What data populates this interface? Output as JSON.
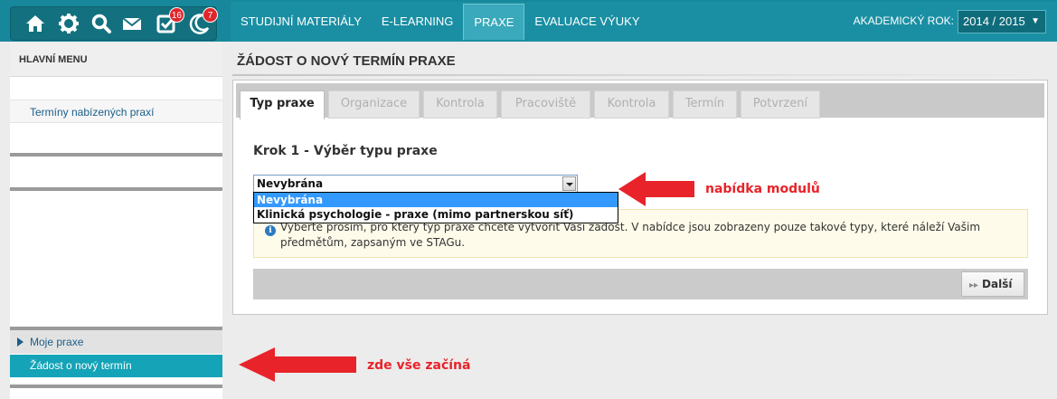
{
  "topbar": {
    "icons": [
      {
        "name": "home-icon"
      },
      {
        "name": "gear-icon"
      },
      {
        "name": "search-icon"
      },
      {
        "name": "mail-icon"
      },
      {
        "name": "tasks-icon",
        "badge": "16"
      },
      {
        "name": "moon-icon",
        "badge": "7"
      }
    ],
    "nav": [
      "STUDIJNÍ MATERIÁLY",
      "E-LEARNING",
      "PRAXE",
      "EVALUACE VÝUKY"
    ],
    "active_nav": "PRAXE",
    "year_label": "AKADEMICKÝ ROK:",
    "year_value": "2014 / 2015",
    "brand_color": "#17889b"
  },
  "sidebar": {
    "heading": "HLAVNÍ MENU",
    "link_terms": "Termíny nabízených praxí",
    "moje_praxe": "Moje praxe",
    "zadost": "Žádost o nový termín"
  },
  "main": {
    "title": "ŽÁDOST O NOVÝ TERMÍN PRAXE",
    "tabs": [
      "Typ praxe",
      "Organizace",
      "Kontrola",
      "Pracoviště",
      "Kontrola",
      "Termín",
      "Potvrzení"
    ],
    "active_tab": "Typ praxe",
    "step_title": "Krok 1 - Výběr typu praxe",
    "select_value": "Nevybrána",
    "options": [
      "Nevybrána",
      "Klinická psychologie - praxe (mimo partnerskou síť)"
    ],
    "selected_option": "Nevybrána",
    "info_text": "Vyberte prosím, pro který typ praxe chcete vytvořit Vaši žádost. V nabídce jsou zobrazeny pouze takové typy, které náleží Vašim předmětům, zapsaným ve STAGu.",
    "next_label": "Další"
  },
  "annotations": {
    "modules": "nabídka modulů",
    "start": "zde vše začíná",
    "color": "#e8232a"
  }
}
